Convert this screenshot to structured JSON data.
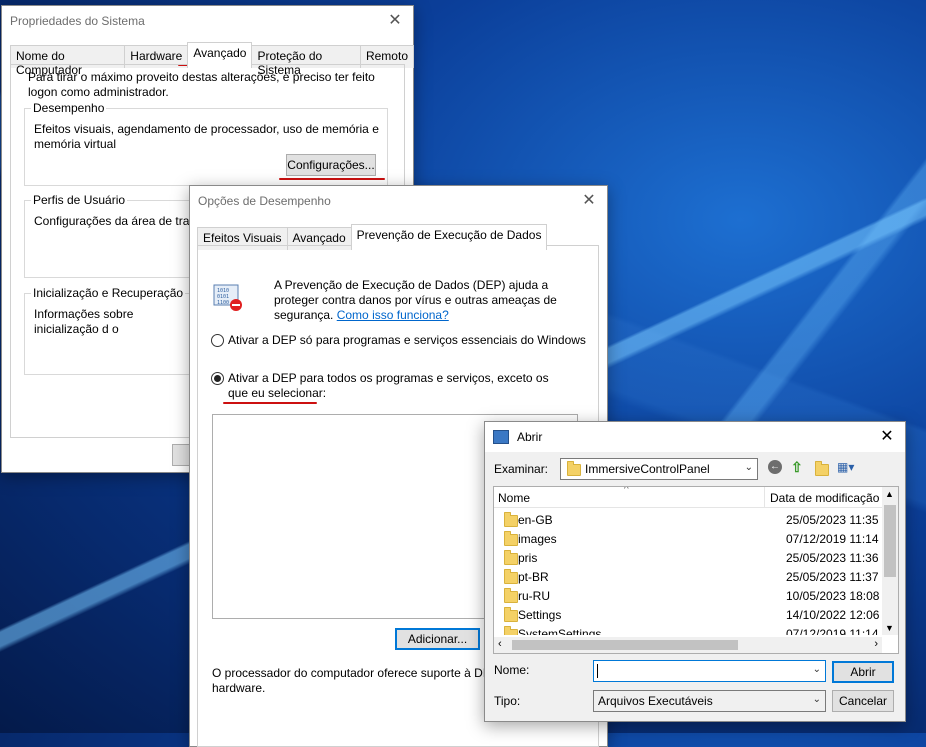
{
  "sys_props": {
    "title": "Propriedades do Sistema",
    "tabs": [
      "Nome do Computador",
      "Hardware",
      "Avançado",
      "Proteção do Sistema",
      "Remoto"
    ],
    "intro": "Para tirar o máximo proveito destas alterações, é preciso ter feito logon como administrador.",
    "perf_title": "Desempenho",
    "perf_desc": "Efeitos visuais, agendamento de processador, uso de memória e memória virtual",
    "perf_button": "Configurações...",
    "profiles_title": "Perfis de Usuário",
    "profiles_desc": "Configurações da área de trabalh",
    "startup_title": "Inicialização e Recuperação",
    "startup_desc": "Informações sobre inicialização d o"
  },
  "perf_options": {
    "title": "Opções de Desempenho",
    "tabs": [
      "Efeitos Visuais",
      "Avançado",
      "Prevenção de Execução de Dados"
    ],
    "dep_desc": "A Prevenção de Execução de Dados (DEP) ajuda a proteger contra danos por vírus e outras ameaças de segurança.",
    "dep_link": "Como isso funciona?",
    "radio1": "Ativar a DEP só para programas e serviços essenciais do Windows",
    "radio2": "Ativar a DEP para todos os programas e serviços, exceto os que eu selecionar:",
    "add_button": "Adicionar...",
    "footer": "O processador do computador oferece suporte à DE hardware."
  },
  "open_dialog": {
    "title": "Abrir",
    "look_in_label": "Examinar:",
    "look_in_value": "ImmersiveControlPanel",
    "col_name": "Nome",
    "col_date": "Data de modificação",
    "files": [
      {
        "name": "en-GB",
        "date": "25/05/2023 11:35"
      },
      {
        "name": "images",
        "date": "07/12/2019 11:14"
      },
      {
        "name": "pris",
        "date": "25/05/2023 11:36"
      },
      {
        "name": "pt-BR",
        "date": "25/05/2023 11:37"
      },
      {
        "name": "ru-RU",
        "date": "10/05/2023 18:08"
      },
      {
        "name": "Settings",
        "date": "14/10/2022 12:06"
      },
      {
        "name": "SystemSettings",
        "date": "07/12/2019 11:14"
      }
    ],
    "name_label": "Nome:",
    "name_value": "",
    "type_label": "Tipo:",
    "type_value": "Arquivos Executáveis",
    "open_button": "Abrir",
    "cancel_button": "Cancelar"
  },
  "colors": {
    "accent": "#0078d7",
    "annotation": "#cc1010",
    "link": "#0066cc"
  }
}
